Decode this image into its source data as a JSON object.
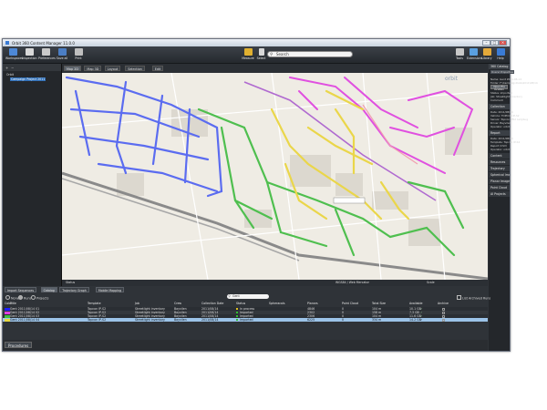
{
  "window": {
    "title": "Orbit 360 Content Manager 11.0.0"
  },
  "toolbar": {
    "items": [
      {
        "label": "Workspaces",
        "icon": "workspaces-icon",
        "color": "#4d88d6"
      },
      {
        "label": "Inspection",
        "icon": "inspection-icon",
        "color": "#d9d9d9"
      },
      {
        "label": "Preferences",
        "icon": "preferences-icon",
        "color": "#c9c9c9"
      },
      {
        "label": "Save all",
        "icon": "save-icon",
        "color": "#4b7ec4"
      },
      {
        "label": "Print",
        "icon": "print-icon",
        "color": "#bfbfbf"
      }
    ],
    "measure_label": "Measure",
    "select_label": "Select",
    "search_placeholder": "Search",
    "right_items": [
      {
        "label": "Tools",
        "icon": "tools-icon",
        "color": "#c8c8c8"
      },
      {
        "label": "Extensions",
        "icon": "extensions-icon",
        "color": "#5aa0e0"
      },
      {
        "label": "Library",
        "icon": "library-icon",
        "color": "#e3a93a"
      },
      {
        "label": "Help",
        "icon": "help-icon",
        "color": "#3a7bd5"
      }
    ]
  },
  "left_tree": {
    "items": [
      {
        "label": "Orbit",
        "selected": false
      },
      {
        "label": "Campaign Project 2011",
        "selected": true
      }
    ]
  },
  "map_tabs": [
    "Map 2D",
    "Map 3D",
    "Layout",
    "Selection",
    "Edit"
  ],
  "map": {
    "logo": "orbit",
    "status_left": "Status",
    "status_mid": "WGS84 / Web Mercator",
    "status_right": "Scale"
  },
  "right_panel": {
    "title": "360 Catalog",
    "tabs": [
      "Overview",
      "Properties"
    ],
    "fields": [
      "Name: Gent 2011-08-14",
      "Folder: F:\\CampaignData\\2011\\08\\14",
      "Open file location",
      "Status: imported",
      "Job: Streetlight inventory",
      "Comment"
    ],
    "collection": {
      "header": "Collection",
      "rows": [
        "Date: 2011/08/14",
        "Vehicle: TOPCON IP-S2",
        "Sensor: Topcon IPS2 Ladybug",
        "Driver: Bayvilen",
        "Operator: orbit"
      ]
    },
    "report": {
      "header": "Report",
      "rows": [
        "Date: 2011/08/14",
        "Template: Topcon IP-S2",
        "Report (CSV)",
        "Operator: orbit"
      ]
    },
    "sections": [
      "Content",
      "Resources",
      "Trajectory",
      "Spherical Images",
      "Planar Images",
      "Point Cloud",
      "AI Projects"
    ]
  },
  "bottom_tabs": [
    "Import Sequences",
    "Catalog",
    "Trajectory Graph",
    "Mobile Mapping"
  ],
  "filters": {
    "radios": [
      "None",
      "Runs",
      "Projects"
    ],
    "search_text": "Gent",
    "checkbox": "List Archived Runs"
  },
  "table": {
    "columns": [
      "Color",
      "Title",
      "Template",
      "Job",
      "Crew",
      "Collection Date",
      "Status",
      "Spheracals",
      "Planars",
      "Point Cloud",
      "Total Size",
      "Available",
      "Archive"
    ],
    "rows": [
      {
        "color": "#1f1fff",
        "title": "Gent 2011/08/14 01",
        "template": "Topcon IP-S2",
        "job": "Streetlight inventory",
        "crew": "Bayvilen",
        "date": "2011/08/14",
        "status": "In process",
        "status_color": "#e0c020",
        "spher": "",
        "planars": "4846",
        "pc": "0",
        "size": "104 m",
        "avail": "10.1 GB",
        "archive": "",
        "selected": false
      },
      {
        "color": "#e040e0",
        "title": "Gent 2011/08/14 02",
        "template": "Topcon IP-S2",
        "job": "Streetlight inventory",
        "crew": "Bayvilen",
        "date": "2011/08/14",
        "status": "Imported",
        "status_color": "#30c030",
        "spher": "",
        "planars": "2302",
        "pc": "0",
        "size": "158 m",
        "avail": "7.3 GB",
        "archive": "",
        "selected": false
      },
      {
        "color": "#40c040",
        "title": "Gent 2011/08/14 03",
        "template": "Topcon IP-S2",
        "job": "Streetlight inventory",
        "crew": "Bayvilen",
        "date": "2011/08/14",
        "status": "Imported",
        "status_color": "#30c030",
        "spher": "",
        "planars": "2306",
        "pc": "0",
        "size": "104 m",
        "avail": "11.6 GB",
        "archive": "",
        "selected": false
      },
      {
        "color": "#e8d840",
        "title": "Gent 2011/08/14 04",
        "template": "Topcon IP-S2",
        "job": "Streetlight inventory",
        "crew": "Bayvilen",
        "date": "2011/08/14",
        "status": "Imported",
        "status_color": "#30c030",
        "spher": "",
        "planars": "6225",
        "pc": "0",
        "size": "334 m",
        "avail": "14.2 GB",
        "archive": "",
        "selected": true
      }
    ]
  },
  "bottom_buttons": {
    "open_run": "Open Run",
    "blank": "",
    "create_project": "Create new Project from selected Runs",
    "archive_run": "Archive Run"
  },
  "procedures_label": "Procedures"
}
